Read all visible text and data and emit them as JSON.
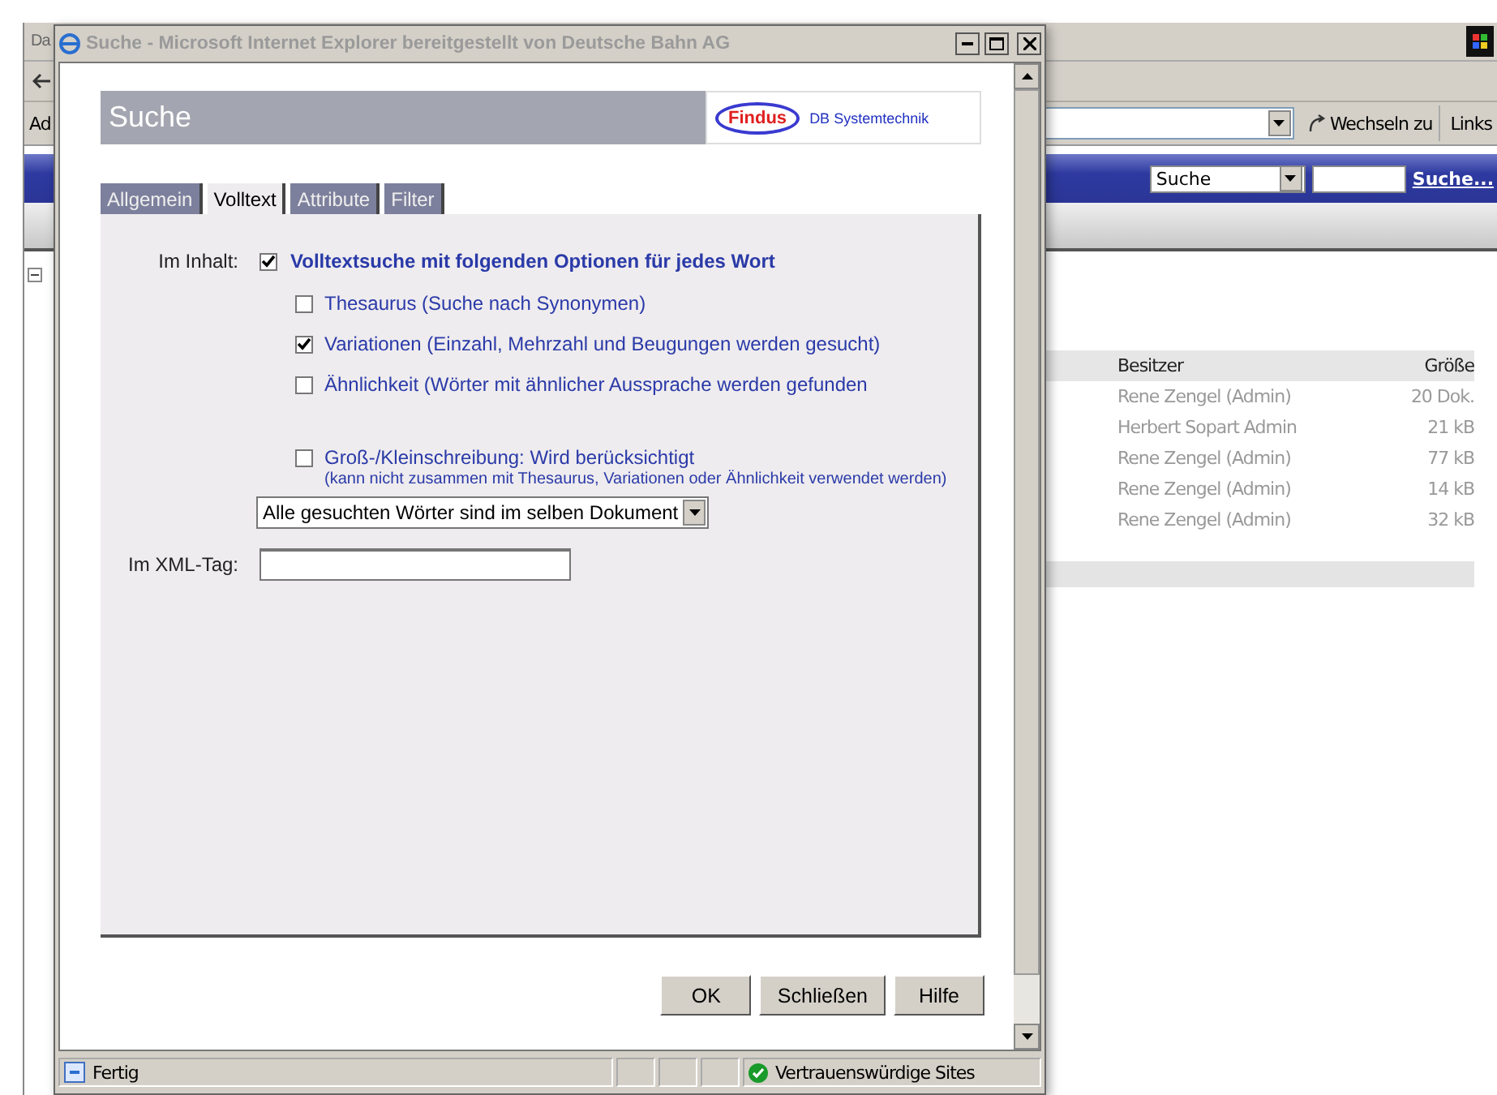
{
  "background_window": {
    "title": "Da",
    "address_label": "Ad",
    "go_button": "Wechseln zu",
    "links_label": "Links",
    "search_select": "Suche",
    "search_link": "Suche...",
    "table": {
      "columns": [
        "Besitzer",
        "Größe"
      ],
      "rows": [
        [
          "Rene Zengel (Admin)",
          "20 Dok."
        ],
        [
          "Herbert Sopart Admin",
          "21 kB"
        ],
        [
          "Rene Zengel (Admin)",
          "77 kB"
        ],
        [
          "Rene Zengel (Admin)",
          "14 kB"
        ],
        [
          "Rene Zengel (Admin)",
          "32 kB"
        ]
      ]
    }
  },
  "popup": {
    "title": "Suche - Microsoft Internet Explorer bereitgestellt von Deutsche Bahn AG",
    "header": "Suche",
    "logo": {
      "name": "Findus",
      "tagline": "DB Systemtechnik"
    },
    "tabs": [
      {
        "label": "Allgemein",
        "selected": false
      },
      {
        "label": "Volltext",
        "selected": true
      },
      {
        "label": "Attribute",
        "selected": false
      },
      {
        "label": "Filter",
        "selected": false
      }
    ],
    "content_label": "Im Inhalt:",
    "fulltext": {
      "label": "Volltextsuche mit folgenden Optionen für jedes Wort",
      "checked": true
    },
    "options": [
      {
        "label": "Thesaurus (Suche nach Synonymen)",
        "checked": false
      },
      {
        "label": "Variationen (Einzahl, Mehrzahl und Beugungen werden gesucht)",
        "checked": true
      },
      {
        "label": "Ähnlichkeit (Wörter mit ähnlicher Aussprache werden gefunden",
        "checked": false
      }
    ],
    "case_option": {
      "label": "Groß-/Kleinschreibung: Wird berücksichtigt",
      "note": "(kann nicht zusammen mit Thesaurus, Variationen oder Ähnlichkeit verwendet werden)",
      "checked": false
    },
    "scope_select": "Alle gesuchten Wörter sind im selben Dokument",
    "xml_label": "Im XML-Tag:",
    "buttons": [
      "OK",
      "Schließen",
      "Hilfe"
    ],
    "status": {
      "text": "Fertig",
      "zone": "Vertrauenswürdige Sites"
    }
  }
}
